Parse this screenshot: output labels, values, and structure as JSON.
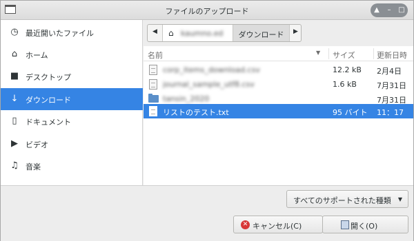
{
  "window": {
    "title": "ファイルのアップロード"
  },
  "window_buttons": {
    "up": "▲",
    "minimize": "–",
    "maximize": "□"
  },
  "sidebar": {
    "items": [
      {
        "label": "最近開いたファイル",
        "icon": "clock-icon",
        "glyph": "◷"
      },
      {
        "label": "ホーム",
        "icon": "home-icon",
        "glyph": "⌂"
      },
      {
        "label": "デスクトップ",
        "icon": "folder-icon",
        "glyph": "■"
      },
      {
        "label": "ダウンロード",
        "icon": "download-icon",
        "glyph": "↓",
        "selected": true
      },
      {
        "label": "ドキュメント",
        "icon": "document-icon",
        "glyph": "▯"
      },
      {
        "label": "ビデオ",
        "icon": "video-icon",
        "glyph": "▶"
      },
      {
        "label": "音楽",
        "icon": "music-icon",
        "glyph": "♫"
      }
    ]
  },
  "pathbar": {
    "left_arrow": "◀",
    "home_label": "kaumno.ed",
    "home_glyph": "⌂",
    "current": "ダウンロード",
    "right_arrow": "▶"
  },
  "filelist": {
    "columns": {
      "name": "名前",
      "sort_glyph": "▼",
      "size": "サイズ",
      "date": "更新日時"
    },
    "rows": [
      {
        "name": "corp_items_download.csv",
        "size": "12.2 kB",
        "date": "2月4日",
        "type": "file",
        "blurred": true
      },
      {
        "name": "journal_sample_utf8.csv",
        "size": "1.6 kB",
        "date": "7月31日",
        "type": "file",
        "blurred": true
      },
      {
        "name": "tansin_2020",
        "size": "",
        "date": "7月31日",
        "type": "folder",
        "blurred": true
      },
      {
        "name": "リストのテスト.txt",
        "size": "95 バイト",
        "date": "11：17",
        "type": "file",
        "blurred": false,
        "selected": true
      }
    ]
  },
  "filter": {
    "label": "すべてのサポートされた種類",
    "glyph": "▼"
  },
  "buttons": {
    "cancel": "キャンセル(C)",
    "cancel_glyph": "✕",
    "open": "開く(O)"
  },
  "colors": {
    "selection": "#3584e4",
    "background": "#ededed"
  }
}
